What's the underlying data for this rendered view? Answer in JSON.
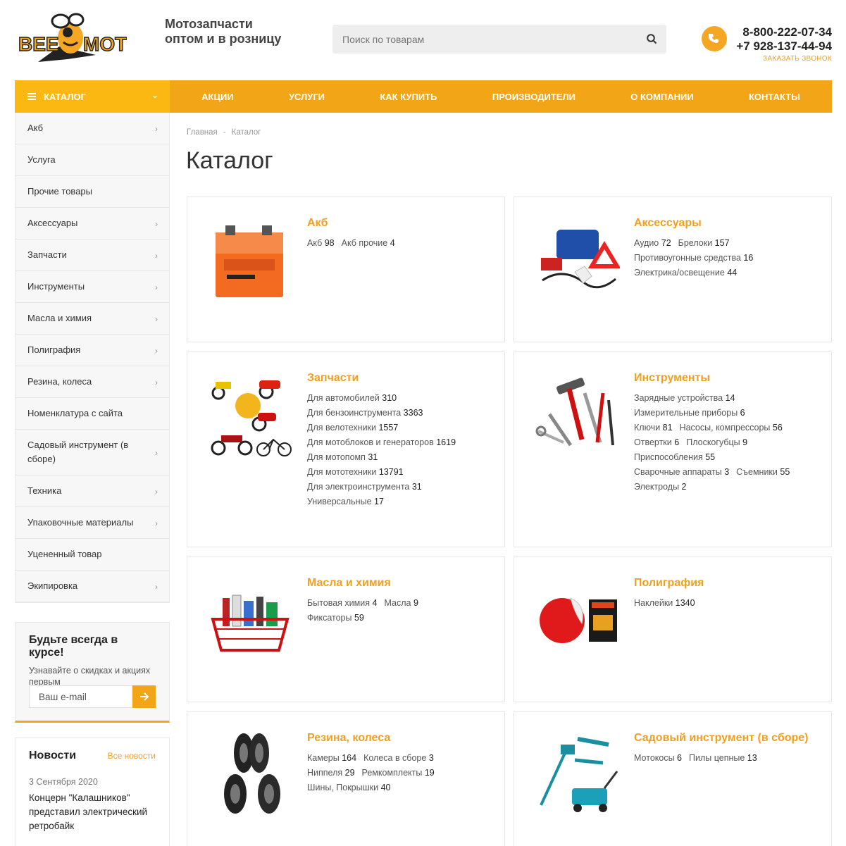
{
  "header": {
    "logo_text": "BEE MOTO",
    "tagline_line1": "Мотозапчасти",
    "tagline_line2": "оптом и в розницу",
    "search_placeholder": "Поиск по товарам",
    "phone1": "8-800-222-07-34",
    "phone2": "+7 928-137-44-94",
    "callback_label": "Заказать звонок",
    "accent_color": "#f2a516"
  },
  "nav": {
    "catalog_label": "Каталог",
    "items": [
      "Акции",
      "Услуги",
      "Как купить",
      "Производители",
      "О компании",
      "Контакты"
    ]
  },
  "sidebar": {
    "items": [
      {
        "label": "Акб",
        "has_arrow": true
      },
      {
        "label": "Услуга",
        "has_arrow": false
      },
      {
        "label": "Прочие товары",
        "has_arrow": false
      },
      {
        "label": "Аксессуары",
        "has_arrow": true
      },
      {
        "label": "Запчасти",
        "has_arrow": true
      },
      {
        "label": "Инструменты",
        "has_arrow": true
      },
      {
        "label": "Масла и химия",
        "has_arrow": true
      },
      {
        "label": "Полиграфия",
        "has_arrow": true
      },
      {
        "label": "Резина, колеса",
        "has_arrow": true
      },
      {
        "label": "Номенклатура с сайта",
        "has_arrow": false
      },
      {
        "label": "Садовый инструмент (в сборе)",
        "has_arrow": true
      },
      {
        "label": "Техника",
        "has_arrow": true
      },
      {
        "label": "Упаковочные материалы",
        "has_arrow": true
      },
      {
        "label": "Уцененный товар",
        "has_arrow": false
      },
      {
        "label": "Экипировка",
        "has_arrow": true
      }
    ]
  },
  "subscribe": {
    "title": "Будьте всегда в курсе!",
    "text": "Узнавайте о скидках и акциях первым",
    "placeholder": "Ваш e-mail"
  },
  "news": {
    "title": "Новости",
    "all_link": "Все новости",
    "date": "3 Сентября 2020",
    "item_title": "Концерн \"Калашников\" представил электрический ретробайк"
  },
  "breadcrumb": {
    "home": "Главная",
    "separator": "-",
    "current": "Каталог"
  },
  "page_title": "Каталог",
  "categories": [
    {
      "title": "Акб",
      "icon": "battery",
      "subs": [
        [
          "Акб",
          "98"
        ],
        [
          "Акб прочие",
          "4"
        ]
      ]
    },
    {
      "title": "Аксессуары",
      "icon": "accessory-kit",
      "subs": [
        [
          "Аудио",
          "72"
        ],
        [
          "Брелоки",
          "157"
        ],
        [
          "Противоугонные средства",
          "16"
        ],
        [
          "Электрика/освещение",
          "44"
        ]
      ]
    },
    {
      "title": "Запчасти",
      "icon": "motorcycles",
      "subs": [
        [
          "Для автомобилей",
          "310"
        ],
        [
          "Для бензоинструмента",
          "3363"
        ],
        [
          "Для велотехники",
          "1557"
        ],
        [
          "Для мотоблоков и генераторов",
          "1619"
        ],
        [
          "Для мотопомп",
          "31"
        ],
        [
          "Для мототехники",
          "13791"
        ],
        [
          "Для электроинструмента",
          "31"
        ],
        [
          "Универсальные",
          "17"
        ]
      ]
    },
    {
      "title": "Инструменты",
      "icon": "tools",
      "subs": [
        [
          "Зарядные устройства",
          "14"
        ],
        [
          "Измерительные приборы",
          "6"
        ],
        [
          "Ключи",
          "81"
        ],
        [
          "Насосы, компрессоры",
          "56"
        ],
        [
          "Отвертки",
          "6"
        ],
        [
          "Плоскогубцы",
          "9"
        ],
        [
          "Приспособления",
          "55"
        ],
        [
          "Сварочные аппараты",
          "3"
        ],
        [
          "Съемники",
          "55"
        ],
        [
          "Электроды",
          "2"
        ]
      ]
    },
    {
      "title": "Масла и химия",
      "icon": "oil-basket",
      "subs": [
        [
          "Бытовая химия",
          "4"
        ],
        [
          "Масла",
          "9"
        ],
        [
          "Фиксаторы",
          "59"
        ]
      ]
    },
    {
      "title": "Полиграфия",
      "icon": "stickers",
      "subs": [
        [
          "Наклейки",
          "1340"
        ]
      ]
    },
    {
      "title": "Резина, колеса",
      "icon": "tires",
      "subs": [
        [
          "Камеры",
          "164"
        ],
        [
          "Колеса в сборе",
          "3"
        ],
        [
          "Ниппеля",
          "29"
        ],
        [
          "Ремкомплекты",
          "19"
        ],
        [
          "Шины, Покрышки",
          "40"
        ]
      ]
    },
    {
      "title": "Садовый инструмент (в сборе)",
      "icon": "garden-tools",
      "subs": [
        [
          "Мотокосы",
          "6"
        ],
        [
          "Пилы цепные",
          "13"
        ]
      ]
    }
  ]
}
